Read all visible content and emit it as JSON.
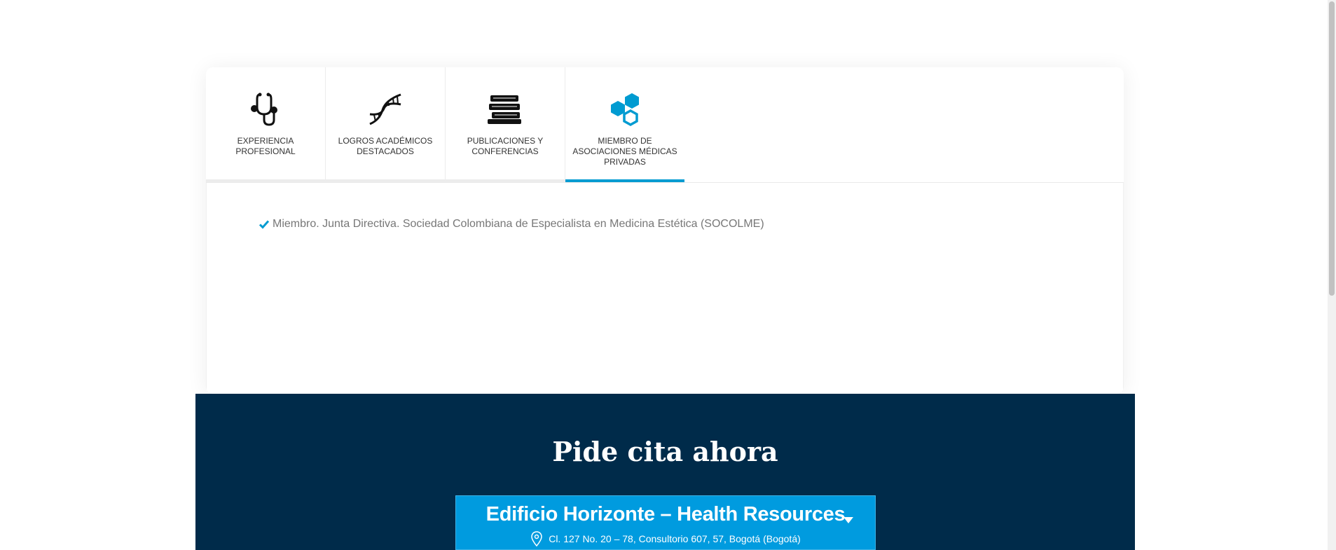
{
  "tabs": [
    {
      "label": "EXPERIENCIA PROFESIONAL",
      "icon": "stethoscope-icon"
    },
    {
      "label": "LOGROS ACADÉMICOS DESTACADOS",
      "icon": "dna-icon"
    },
    {
      "label": "PUBLICACIONES Y CONFERENCIAS",
      "icon": "books-icon"
    },
    {
      "label": "MIEMBRO DE ASOCIACIONES MÉDICAS PRIVADAS",
      "icon": "hexagons-icon"
    }
  ],
  "active_tab_index": 3,
  "panel": {
    "items": [
      "Miembro. Junta Directiva. Sociedad Colombiana de Especialista en Medicina Estética (SOCOLME)"
    ]
  },
  "cita": {
    "title": "Pide cita ahora",
    "location_name": "Edificio Horizonte – Health Resources",
    "location_address": "Cl. 127 No. 20 – 78, Consultorio 607, 57, Bogotá (Bogotá)"
  },
  "colors": {
    "accent": "#009bd1",
    "dark_band": "#002b4a",
    "location_box": "#009bdf"
  }
}
